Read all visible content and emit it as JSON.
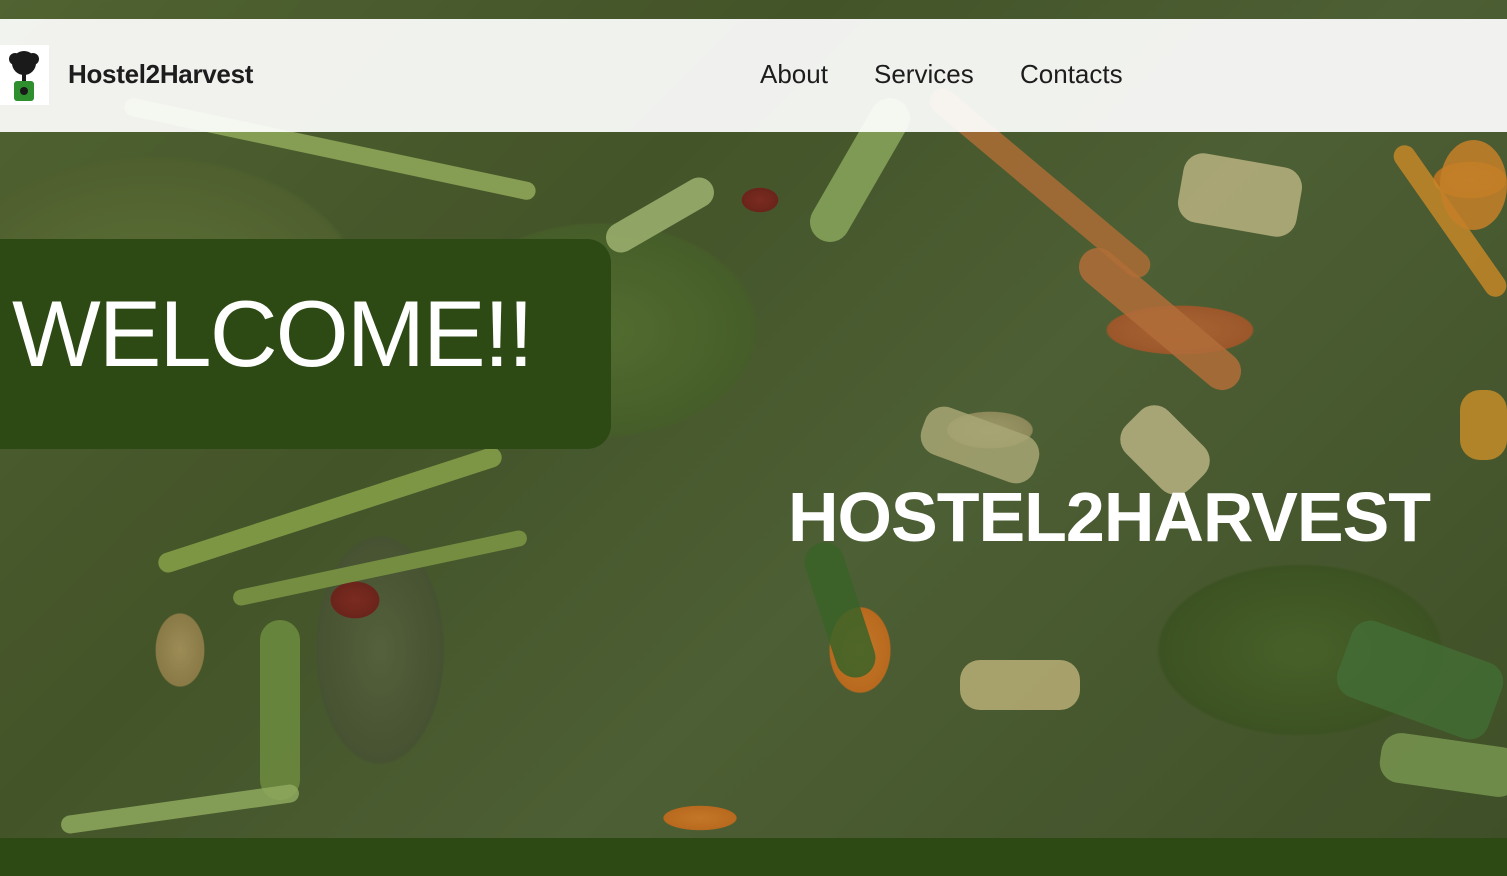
{
  "header": {
    "brand": "Hostel2Harvest",
    "logo_icon": "tree-compost-bin-icon",
    "nav": [
      {
        "label": "About"
      },
      {
        "label": "Services"
      },
      {
        "label": "Contacts"
      }
    ]
  },
  "hero": {
    "welcome": "WELCOME!!",
    "title": "HOSTEL2HARVEST",
    "background": "compost-food-scraps-image"
  },
  "colors": {
    "accent": "#2d4a14",
    "navbar": "#ffffff",
    "text_dark": "#1d1d1d",
    "text_light": "#ffffff"
  }
}
